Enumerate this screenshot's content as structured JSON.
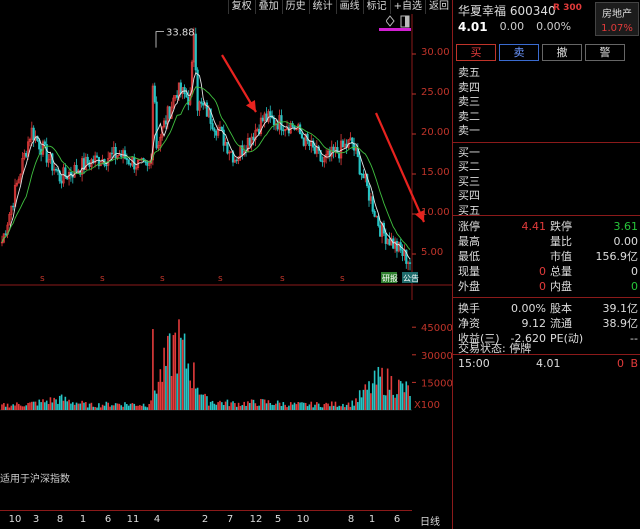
{
  "toolbar": {
    "items": [
      "复权",
      "叠加",
      "历史",
      "统计",
      "画线",
      "标记",
      "+自选",
      "返回"
    ]
  },
  "chart": {
    "peak_label": "33.88",
    "price_axis": [
      "30.00",
      "25.00",
      "20.00",
      "15.00",
      "10.00",
      "5.00"
    ],
    "volume_axis": [
      "45000",
      "30000",
      "15000"
    ],
    "volume_unit": "X100",
    "event_markers": [
      "s",
      "s",
      "s",
      "s",
      "s",
      "s",
      "s",
      "s"
    ],
    "event_tags": [
      "研报",
      "公告"
    ],
    "index_note": "适用于沪深指数",
    "date_ticks": [
      "10",
      "3",
      "8",
      "1",
      "6",
      "11",
      "4",
      "2",
      "7",
      "12",
      "5",
      "10",
      "8",
      "1",
      "6"
    ],
    "period_label": "日线",
    "colors": {
      "up": "#e23b3b",
      "down": "#27c4c4",
      "ma_fast": "#e6e6e6",
      "ma_slow": "#3fbf3f",
      "arrow": "#e8231f"
    }
  },
  "chart_data": {
    "type": "line",
    "title": "",
    "xlabel": "",
    "ylabel": "",
    "ylim": [
      4,
      34
    ],
    "x": [
      "10",
      "3",
      "8",
      "1",
      "6",
      "11",
      "4",
      "2",
      "7",
      "12",
      "5",
      "10",
      "8",
      "1",
      "6"
    ],
    "series": [
      {
        "values": [
          6.5,
          20.5,
          14.5,
          16.5,
          17.5,
          15.5,
          25.5,
          23.0,
          17.0,
          22.0,
          21.0,
          16.5,
          19.0,
          8.0,
          4.0
        ]
      }
    ],
    "volume_ylim": [
      0,
      50000
    ],
    "volume_values": [
      3000,
      4000,
      7000,
      3000,
      4000,
      3500,
      44000,
      6000,
      4000,
      5000,
      3500,
      3500,
      4000,
      20000,
      12000
    ],
    "volume_unit": "X100"
  },
  "quote": {
    "name": "华夏幸福",
    "code": "600340",
    "rating": "R 300",
    "sector": "房地产",
    "sector_change": "1.07%",
    "last_price": "4.01",
    "change": "0.00",
    "change_pct": "0.00%",
    "buttons": {
      "buy": "买",
      "sell": "卖",
      "cancel": "撤",
      "alert": "警"
    },
    "asks": [
      "卖五",
      "卖四",
      "卖三",
      "卖二",
      "卖一"
    ],
    "bids": [
      "买一",
      "买二",
      "买三",
      "买四",
      "买五"
    ],
    "stats_a": [
      {
        "l1": "涨停",
        "v1": "4.41",
        "l2": "跌停",
        "v2": "3.61"
      },
      {
        "l1": "最高",
        "v1": "",
        "l2": "量比",
        "v2": "0.00"
      },
      {
        "l1": "最低",
        "v1": "",
        "l2": "市值",
        "v2": "156.9亿"
      },
      {
        "l1": "现量",
        "v1": "0",
        "l2": "总量",
        "v2": "0"
      },
      {
        "l1": "外盘",
        "v1": "0",
        "l2": "内盘",
        "v2": "0"
      }
    ],
    "stats_b": [
      {
        "l1": "换手",
        "v1": "0.00%",
        "l2": "股本",
        "v2": "39.1亿"
      },
      {
        "l1": "净资",
        "v1": "9.12",
        "l2": "流通",
        "v2": "38.9亿"
      },
      {
        "l1": "收益(三)",
        "v1": "-2.620",
        "l2": "PE(动)",
        "v2": "--"
      }
    ],
    "trade_status": "交易状态: 停牌",
    "tick": {
      "time": "15:00",
      "price": "4.01",
      "volume": "0",
      "side": "B"
    }
  }
}
